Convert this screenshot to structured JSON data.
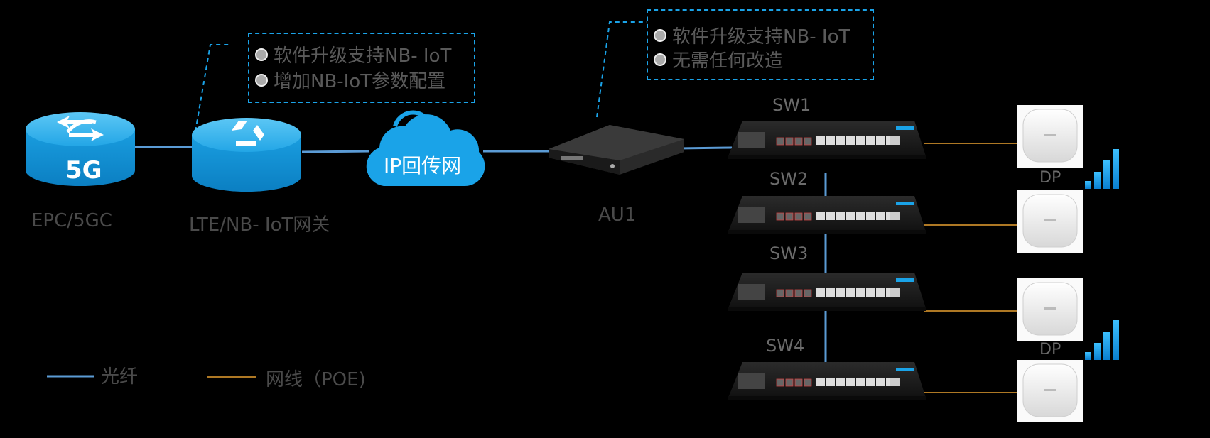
{
  "nodes": {
    "epc": {
      "label": "EPC/5GC",
      "badge": "5G"
    },
    "gateway": {
      "label": "LTE/NB- IoT网关"
    },
    "backhaul": {
      "label": "IP回传网"
    },
    "au": {
      "label": "AU1"
    },
    "switches": [
      "SW1",
      "SW2",
      "SW3",
      "SW4"
    ],
    "dp_labels": [
      "DP",
      "DP"
    ]
  },
  "notes": {
    "gateway": [
      "软件升级支持NB- IoT",
      "增加NB-IoT参数配置"
    ],
    "au": [
      "软件升级支持NB- IoT",
      "无需任何改造"
    ]
  },
  "legend": {
    "fiber": "光纤",
    "cable": "网线（POE)"
  },
  "colors": {
    "fiber": "#5b9bd5",
    "cable": "#e8a030",
    "accent": "#1aa3e8"
  },
  "icons": [
    "router-icon",
    "gateway-icon",
    "cloud-icon",
    "au-device-icon",
    "switch-icon",
    "access-point-icon",
    "signal-icon"
  ]
}
